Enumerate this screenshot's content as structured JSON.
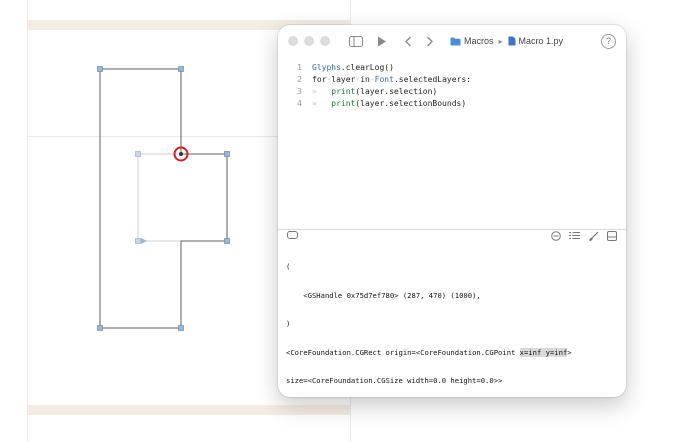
{
  "window": {
    "breadcrumb": {
      "folder": "Macros",
      "file": "Macro 1.py"
    },
    "help_label": "?"
  },
  "editor": {
    "lines": [
      {
        "num": "1",
        "indent": "",
        "parts": [
          {
            "t": "Glyphs",
            "c": "tok-name"
          },
          {
            "t": ".clearLog()",
            "c": ""
          }
        ]
      },
      {
        "num": "2",
        "indent": "",
        "parts": [
          {
            "t": "for",
            "c": "tok-kw"
          },
          {
            "t": "·",
            "c": "dot"
          },
          {
            "t": "layer",
            "c": ""
          },
          {
            "t": "·",
            "c": "dot"
          },
          {
            "t": "in",
            "c": "tok-kw"
          },
          {
            "t": "·",
            "c": "dot"
          },
          {
            "t": "Font",
            "c": "tok-name"
          },
          {
            "t": ".selectedLayers:",
            "c": ""
          }
        ]
      },
      {
        "num": "3",
        "indent": "»   ",
        "parts": [
          {
            "t": "print",
            "c": "tok-fn"
          },
          {
            "t": "(layer.selection)",
            "c": ""
          }
        ]
      },
      {
        "num": "4",
        "indent": "»   ",
        "parts": [
          {
            "t": "print",
            "c": "tok-fn"
          },
          {
            "t": "(layer.selectionBounds)",
            "c": ""
          }
        ]
      }
    ]
  },
  "console": {
    "line1": "(",
    "line2": "    <GSHandle 0x75d7ef780> (287, 470) (1000),",
    "line3": ")",
    "line4_before": "<CoreFoundation.CGRect origin=<CoreFoundation.CGPoint ",
    "line4_highlight": "x=inf y=inf",
    "line4_after": ">",
    "line5": "size=<CoreFoundation.CGSize width=0.0 height=0.0>>"
  },
  "colors": {
    "selection_marker": "#d0202a",
    "glyph_outline": "#555555",
    "node_fill": "#9ab7d8",
    "band": "#f5ede4"
  },
  "icons": [
    "sidebar-toggle-icon",
    "run-icon",
    "back-icon",
    "forward-icon",
    "folder-icon",
    "file-icon",
    "help-icon",
    "console-toggle-icon",
    "clear-icon",
    "list-icon",
    "brush-icon",
    "panel-icon"
  ]
}
